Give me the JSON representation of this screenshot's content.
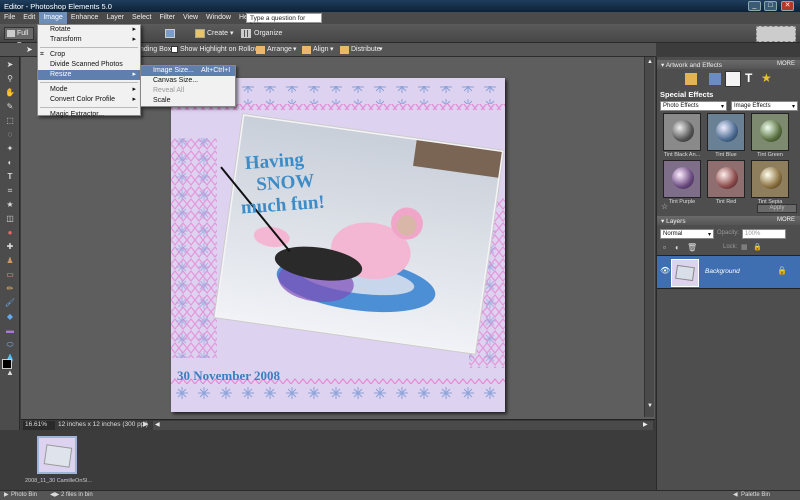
{
  "window": {
    "title": "Editor - Photoshop Elements 5.0"
  },
  "menubar": {
    "items": [
      "File",
      "Edit",
      "Image",
      "Enhance",
      "Layer",
      "Select",
      "Filter",
      "View",
      "Window",
      "Help"
    ],
    "help_placeholder": "Type a question for help"
  },
  "toolbar": {
    "full_edit": "Full E",
    "create": "Create",
    "organize": "Organize"
  },
  "options": {
    "bounding_box": "nding Box",
    "show_highlight": "Show Highlight on Rollover",
    "arrange": "Arrange",
    "align": "Align",
    "distribute": "Distribute"
  },
  "image_menu": {
    "items": [
      "Rotate",
      "Transform",
      "Crop",
      "Divide Scanned Photos",
      "Resize",
      "Mode",
      "Convert Color Profile",
      "Magic Extractor..."
    ],
    "submenu_arrows": [
      true,
      true,
      false,
      false,
      true,
      true,
      true,
      false
    ]
  },
  "resize_submenu": {
    "items": [
      "Image Size...",
      "Canvas Size...",
      "Reveal All",
      "Scale"
    ],
    "shortcut": "Alt+Ctrl+I"
  },
  "document": {
    "title_text": "Having SNOW much fun!",
    "date_text": "30 November 2008"
  },
  "status": {
    "zoom": "16.61%",
    "doc_info": "12 inches x 12 inches (300 ppi)"
  },
  "photobin": {
    "thumb_label": "2008_11_30 CamilleOnSl...",
    "label": "Photo Bin",
    "count": "2 files in bin",
    "palette_bin": "Palette Bin"
  },
  "artwork_panel": {
    "title": "Artwork and Effects",
    "more": "MORE",
    "section": "Special Effects",
    "category": "Photo Effects",
    "subcategory": "Image Effects",
    "effects": [
      "Tint Black An...",
      "Tint Blue",
      "Tint Green",
      "Tint Purple",
      "Tint Red",
      "Tint Sepia"
    ],
    "apply": "Apply"
  },
  "layers_panel": {
    "title": "Layers",
    "more": "MORE",
    "blend_mode": "Normal",
    "opacity_label": "Opacity:",
    "opacity_value": "100%",
    "lock_label": "Lock:",
    "layer_name": "Background"
  }
}
